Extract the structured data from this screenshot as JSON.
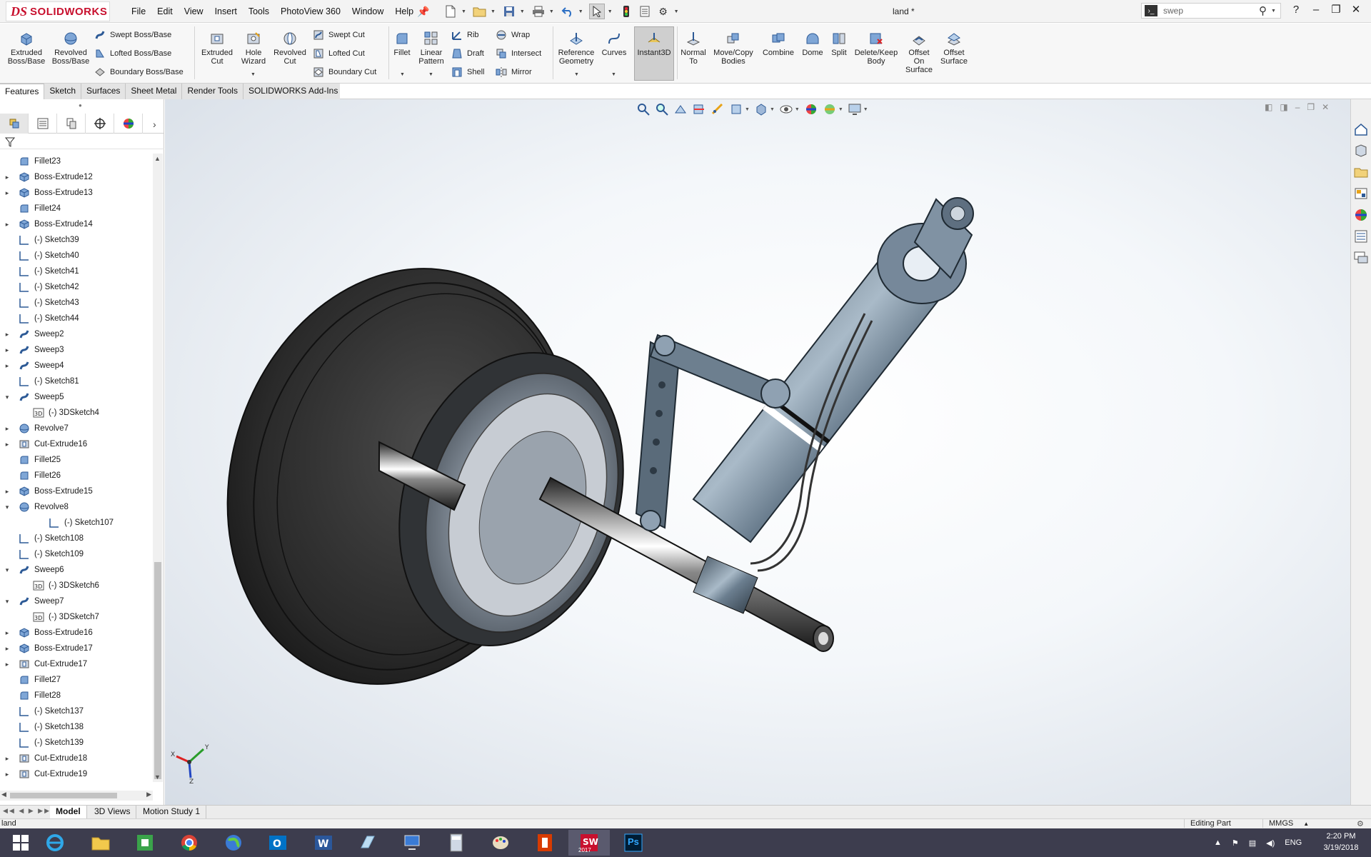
{
  "app": {
    "logo_ds": "DS",
    "logo_text": "SOLIDWORKS",
    "document_title": "land *"
  },
  "menu": [
    "File",
    "Edit",
    "View",
    "Insert",
    "Tools",
    "PhotoView 360",
    "Window",
    "Help"
  ],
  "search": {
    "value": "swep",
    "placeholder": "Search Commands"
  },
  "ribbon": {
    "extruded_boss": "Extruded Boss/Base",
    "revolved_boss": "Revolved Boss/Base",
    "swept_boss": "Swept Boss/Base",
    "lofted_boss": "Lofted Boss/Base",
    "boundary_boss": "Boundary Boss/Base",
    "extruded_cut": "Extruded Cut",
    "hole_wizard": "Hole Wizard",
    "revolved_cut": "Revolved Cut",
    "swept_cut": "Swept Cut",
    "lofted_cut": "Lofted Cut",
    "boundary_cut": "Boundary Cut",
    "fillet": "Fillet",
    "linear_pattern": "Linear Pattern",
    "rib": "Rib",
    "draft": "Draft",
    "shell": "Shell",
    "wrap": "Wrap",
    "intersect": "Intersect",
    "mirror": "Mirror",
    "reference_geometry": "Reference Geometry",
    "curves": "Curves",
    "instant3d": "Instant3D",
    "normal_to": "Normal To",
    "move_copy": "Move/Copy Bodies",
    "combine": "Combine",
    "dome": "Dome",
    "split": "Split",
    "delete_keep": "Delete/Keep Body",
    "offset_on_surface": "Offset On Surface",
    "offset_surface": "Offset Surface"
  },
  "tabs": [
    "Features",
    "Sketch",
    "Surfaces",
    "Sheet Metal",
    "Render Tools",
    "SOLIDWORKS Add-Ins"
  ],
  "tree": [
    {
      "label": "Fillet23",
      "type": "fillet",
      "exp": ""
    },
    {
      "label": "Boss-Extrude12",
      "type": "boss",
      "exp": "▸"
    },
    {
      "label": "Boss-Extrude13",
      "type": "boss",
      "exp": "▸"
    },
    {
      "label": "Fillet24",
      "type": "fillet",
      "exp": ""
    },
    {
      "label": "Boss-Extrude14",
      "type": "boss",
      "exp": "▸"
    },
    {
      "label": "(-) Sketch39",
      "type": "sketch",
      "exp": ""
    },
    {
      "label": "(-) Sketch40",
      "type": "sketch",
      "exp": ""
    },
    {
      "label": "(-) Sketch41",
      "type": "sketch",
      "exp": ""
    },
    {
      "label": "(-) Sketch42",
      "type": "sketch",
      "exp": ""
    },
    {
      "label": "(-) Sketch43",
      "type": "sketch",
      "exp": ""
    },
    {
      "label": "(-) Sketch44",
      "type": "sketch",
      "exp": ""
    },
    {
      "label": "Sweep2",
      "type": "sweep",
      "exp": "▸"
    },
    {
      "label": "Sweep3",
      "type": "sweep",
      "exp": "▸"
    },
    {
      "label": "Sweep4",
      "type": "sweep",
      "exp": "▸"
    },
    {
      "label": "(-) Sketch81",
      "type": "sketch",
      "exp": ""
    },
    {
      "label": "Sweep5",
      "type": "sweep",
      "exp": "▾"
    },
    {
      "label": "(-) 3DSketch4",
      "type": "sketch3d",
      "exp": "",
      "child": 1
    },
    {
      "label": "Revolve7",
      "type": "revolve",
      "exp": "▸"
    },
    {
      "label": "Cut-Extrude16",
      "type": "cut",
      "exp": "▸"
    },
    {
      "label": "Fillet25",
      "type": "fillet",
      "exp": ""
    },
    {
      "label": "Fillet26",
      "type": "fillet",
      "exp": ""
    },
    {
      "label": "Boss-Extrude15",
      "type": "boss",
      "exp": "▸"
    },
    {
      "label": "Revolve8",
      "type": "revolve",
      "exp": "▾"
    },
    {
      "label": "(-) Sketch107",
      "type": "sketch",
      "exp": "",
      "child": 2
    },
    {
      "label": "(-) Sketch108",
      "type": "sketch",
      "exp": ""
    },
    {
      "label": "(-) Sketch109",
      "type": "sketch",
      "exp": ""
    },
    {
      "label": "Sweep6",
      "type": "sweep",
      "exp": "▾"
    },
    {
      "label": "(-) 3DSketch6",
      "type": "sketch3d",
      "exp": "",
      "child": 1
    },
    {
      "label": "Sweep7",
      "type": "sweep",
      "exp": "▾"
    },
    {
      "label": "(-) 3DSketch7",
      "type": "sketch3d",
      "exp": "",
      "child": 1
    },
    {
      "label": "Boss-Extrude16",
      "type": "boss",
      "exp": "▸"
    },
    {
      "label": "Boss-Extrude17",
      "type": "boss",
      "exp": "▸"
    },
    {
      "label": "Cut-Extrude17",
      "type": "cut",
      "exp": "▸"
    },
    {
      "label": "Fillet27",
      "type": "fillet",
      "exp": ""
    },
    {
      "label": "Fillet28",
      "type": "fillet",
      "exp": ""
    },
    {
      "label": "(-) Sketch137",
      "type": "sketch",
      "exp": ""
    },
    {
      "label": "(-) Sketch138",
      "type": "sketch",
      "exp": ""
    },
    {
      "label": "(-) Sketch139",
      "type": "sketch",
      "exp": ""
    },
    {
      "label": "Cut-Extrude18",
      "type": "cut",
      "exp": "▸"
    },
    {
      "label": "Cut-Extrude19",
      "type": "cut",
      "exp": "▸"
    }
  ],
  "bottom_tabs": [
    "Model",
    "3D Views",
    "Motion Study 1"
  ],
  "status": {
    "left": "land",
    "mode": "Editing Part",
    "units": "MMGS"
  },
  "taskbar": {
    "lang": "ENG",
    "time": "2:20 PM",
    "date": "3/19/2018",
    "sw_version": "2017",
    "ps_label": "Ps"
  },
  "colors": {
    "accent": "#2c6fc4",
    "brand": "#c8102e",
    "taskbar": "#3d3d4e"
  }
}
